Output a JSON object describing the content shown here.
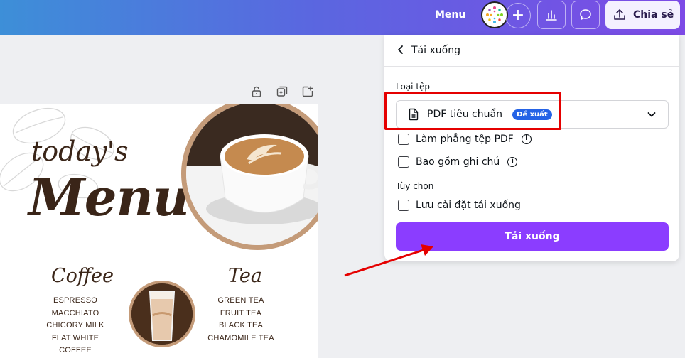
{
  "topbar": {
    "menu_label": "Menu",
    "plus_icon": "+",
    "share_label": "Chia sẻ",
    "gradient_colors": [
      "#3d8fd8",
      "#7d4ae6"
    ]
  },
  "design": {
    "todays": "today's",
    "big_menu": "Menu",
    "coffee": {
      "title": "Coffee",
      "items": [
        "ESPRESSO MACCHIATO",
        "CHICORY MILK",
        "FLAT WHITE",
        "COFFEE"
      ]
    },
    "tea": {
      "title": "Tea",
      "items": [
        "GREEN TEA",
        "FRUIT TEA",
        "BLACK TEA",
        "CHAMOMILE TEA"
      ]
    },
    "accent_color": "#c49b79",
    "text_color": "#3a2518"
  },
  "panel": {
    "title": "Tải xuống",
    "file_type_label": "Loại tệp",
    "file_type_value": "PDF tiêu chuẩn",
    "recommended_badge": "Đề xuất",
    "flatten_label": "Làm phẳng tệp PDF",
    "notes_label": "Bao gồm ghi chú",
    "options_label": "Tùy chọn",
    "save_settings_label": "Lưu cài đặt tải xuống",
    "download_button": "Tải xuống",
    "info_glyph": "i",
    "button_color": "#8b3dff",
    "badge_color": "#2563e6"
  },
  "annotations": {
    "color": "#e50000"
  }
}
